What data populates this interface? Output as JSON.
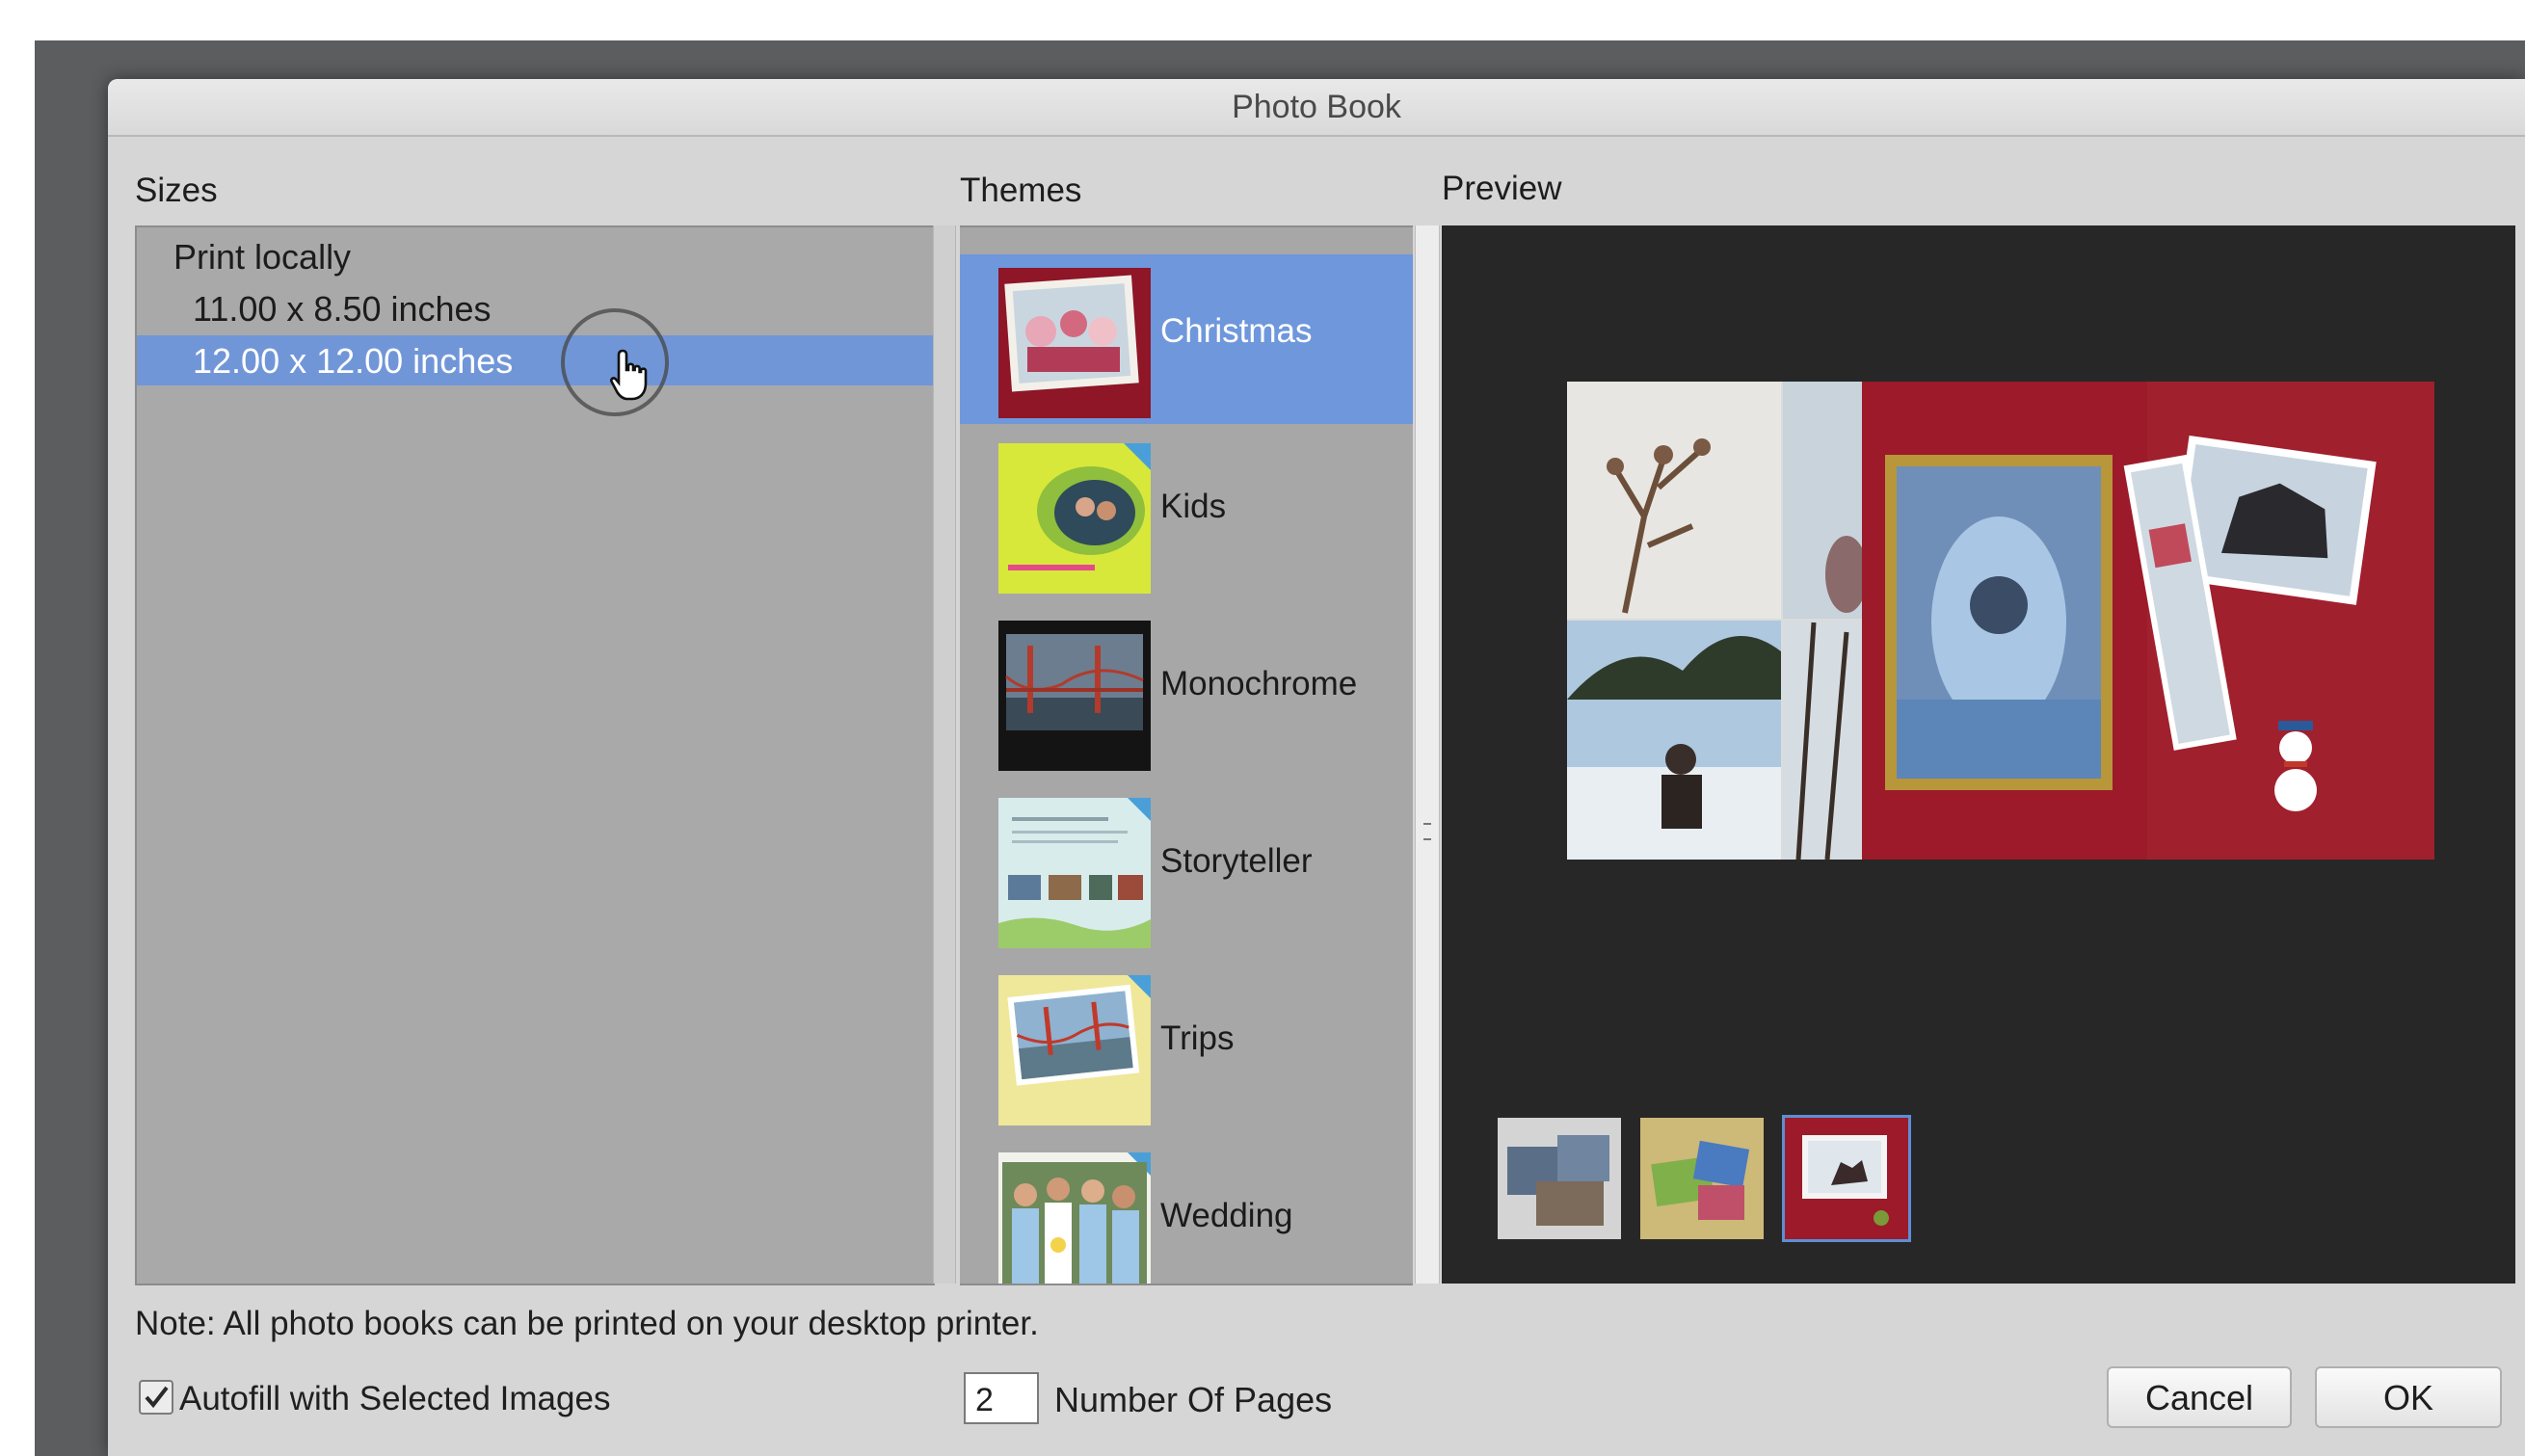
{
  "dialog": {
    "title": "Photo Book"
  },
  "sizes": {
    "label": "Sizes",
    "group": "Print locally",
    "options": [
      "11.00 x 8.50 inches",
      "12.00 x 12.00 inches"
    ],
    "selected_index": 1
  },
  "themes": {
    "label": "Themes",
    "items": [
      {
        "label": "Christmas",
        "selected": true
      },
      {
        "label": "Kids",
        "selected": false
      },
      {
        "label": "Monochrome",
        "selected": false
      },
      {
        "label": "Storyteller",
        "selected": false
      },
      {
        "label": "Trips",
        "selected": false
      },
      {
        "label": "Wedding",
        "selected": false
      }
    ]
  },
  "preview": {
    "label": "Preview",
    "page_thumbnails": [
      "thumbnail-1",
      "thumbnail-2",
      "thumbnail-3"
    ],
    "selected_thumbnail": 2
  },
  "footer": {
    "note": "Note: All photo books can be printed on your desktop printer.",
    "autofill_label": "Autofill with Selected Images",
    "autofill_checked": true,
    "pages_value": "2",
    "pages_label": "Number Of Pages",
    "cancel_label": "Cancel",
    "ok_label": "OK"
  },
  "colors": {
    "selection": "#7196d8",
    "theme_selection": "#6f97dc",
    "preview_bg": "#272727"
  }
}
